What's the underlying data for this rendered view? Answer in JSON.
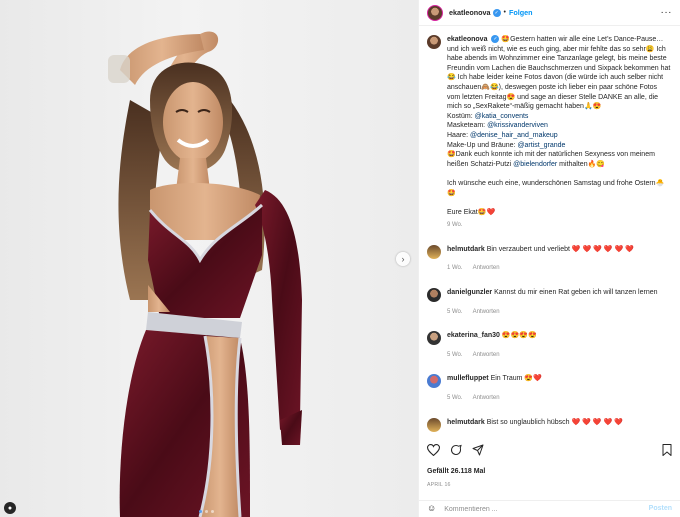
{
  "header": {
    "username": "ekatleonova",
    "follow_label": "Folgen",
    "more_icon": "more-horizontal-icon"
  },
  "caption": {
    "username": "ekatleonova",
    "line1": "🤩Gestern hatten wir alle eine Let’s Dance-Pause…und ich weiß nicht, wie es euch ging, aber mir fehlte das so sehr😩 Ich habe abends im Wohnzimmer eine Tanzanlage gelegt, bis meine beste Freundin vom Lachen die Bauchschmerzen und Sixpack bekommen hat😂 Ich habe leider keine Fotos davon (die würde ich auch selber nicht anschauen🙈😂), deswegen poste ich lieber ein paar schöne Fotos vom letzten Freitag😍 und sage an dieser Stelle DANKE an alle, die mich so „SexRakete“-mäßig gemacht haben🙏😍",
    "kostuem_label": "Kostüm: ",
    "kostuem_link": "@katia_convents",
    "maske_label": "Masketeam: ",
    "maske_link": "@krissivanderviven",
    "haare_label": "Haare: ",
    "haare_link": "@denise_hair_and_makeup",
    "makeup_label": "Make-Up und Bräune: ",
    "makeup_link": "@artist_grande",
    "dank_text": "🤩Dank euch konnte ich mit der natürlichen Sexyness von meinem heißen Schatzi-Putzi ",
    "dank_link": "@bielendorfer",
    "dank_end": " mithalten🔥😋",
    "wish": "Ich wünsche euch eine, wunderschönen Samstag und frohe Ostern🐣🤩",
    "signoff": "Eure Ekat🤩❤️",
    "age": "9 Wo."
  },
  "comments": [
    {
      "user": "helmutdark",
      "text": "Bin verzaubert und verliebt ❤️ ❤️ ❤️ ❤️ ❤️ ❤️",
      "age": "1 Wo.",
      "reply": "Antworten"
    },
    {
      "user": "danielgunzler",
      "text": "Kannst du mir einen Rat geben ich will tanzen lernen",
      "age": "5 Wo.",
      "reply": "Antworten"
    },
    {
      "user": "ekaterina_fan30",
      "text": "😍😍😍😍",
      "age": "5 Wo.",
      "reply": "Antworten"
    },
    {
      "user": "mullefluppet",
      "text": "Ein Traum 😍❤️",
      "age": "5 Wo.",
      "reply": "Antworten"
    },
    {
      "user": "helmutdark",
      "text": "Bist so unglaublich hübsch ❤️ ❤️ ❤️ ❤️ ❤️",
      "age": "",
      "reply": ""
    }
  ],
  "stats": {
    "likes": "Gefällt 26.118 Mal",
    "date": "APRIL 16"
  },
  "compose": {
    "placeholder": "Kommentieren ...",
    "post_label": "Posten"
  },
  "colors": {
    "accent": "#0095f6",
    "verified": "#3897f0",
    "dress": "#5a0f1c"
  }
}
